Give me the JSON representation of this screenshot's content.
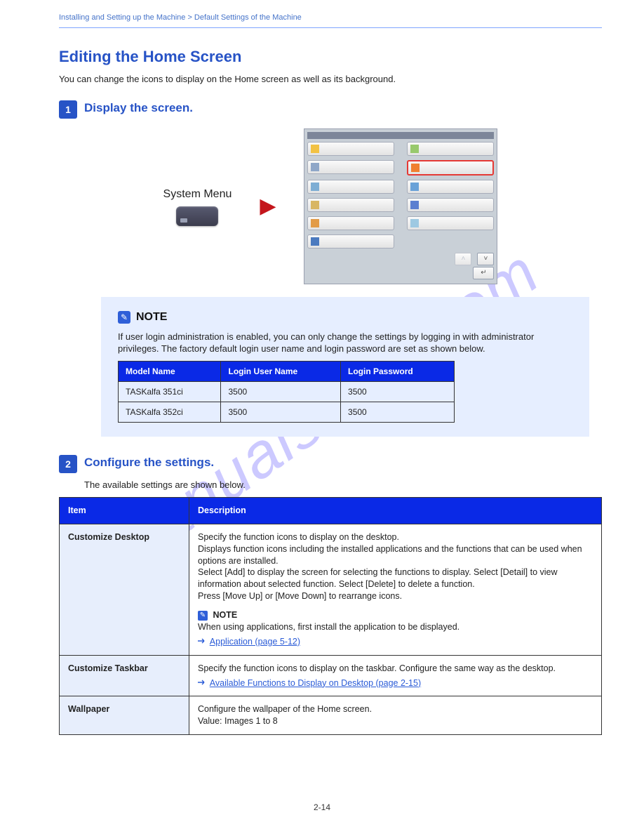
{
  "watermark": "manualshive.com",
  "header": {
    "chapter": "Installing and Setting up the Machine > Default Settings of the Machine",
    "subtitle": ""
  },
  "title": "Editing the Home Screen",
  "lead": "You can change the icons to display on the Home screen as well as its background.",
  "steps": {
    "1": {
      "num": "1",
      "label": "Display the screen."
    },
    "2": {
      "num": "2",
      "label": "Configure the settings."
    }
  },
  "figure": {
    "system_menu_caption": "System Menu",
    "arrow_glyph": "▶"
  },
  "note": {
    "title": "NOTE",
    "body": "If user login administration is enabled, you can only change the settings by logging in with administrator privileges. The factory default login user name and login password are set as shown below."
  },
  "login_table": {
    "headers": [
      "Model Name",
      "Login User Name",
      "Login Password"
    ],
    "rows": [
      [
        "TASKalfa 351ci",
        "3500",
        "3500"
      ],
      [
        "TASKalfa 352ci",
        "3500",
        "3500"
      ]
    ]
  },
  "settings_intro": "The available settings are shown below.",
  "main_table": {
    "headers": [
      "Item",
      "Description"
    ],
    "rows": [
      {
        "key": "Customize Desktop",
        "desc": "Specify the function icons to display on the desktop.\nDisplays function icons including the installed applications and the functions that can be used when options are installed.\nSelect [Add] to display the screen for selecting the functions to display. Select [Detail] to view information about selected function. Select [Delete] to delete a function.\nPress [Move Up] or [Move Down] to rearrange icons.",
        "note_label": "NOTE",
        "note_text": "When using applications, first install the application to be displayed.",
        "ref_text": "Application (page 5-12)"
      },
      {
        "key": "Customize Taskbar",
        "desc": "Specify the function icons to display on the taskbar. Configure the same way as the desktop.",
        "ref_text": "Available Functions to Display on Desktop (page 2-15)"
      },
      {
        "key": "Wallpaper",
        "desc": "Configure the wallpaper of the Home screen.",
        "value_line": "Value: Images 1 to 8"
      }
    ]
  },
  "page_number": "2-14"
}
